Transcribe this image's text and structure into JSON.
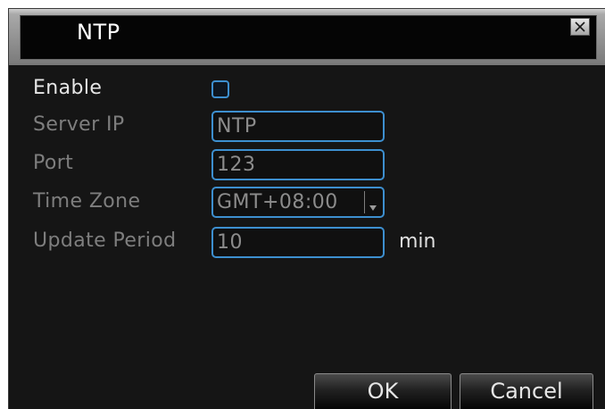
{
  "window": {
    "title": "NTP"
  },
  "form": {
    "enable_label": "Enable",
    "enable_checked": false,
    "server_ip_label": "Server IP",
    "server_ip_value": "NTP",
    "port_label": "Port",
    "port_value": "123",
    "time_zone_label": "Time Zone",
    "time_zone_value": "GMT+08:00",
    "update_period_label": "Update Period",
    "update_period_value": "10",
    "update_period_unit": "min"
  },
  "buttons": {
    "ok_label": "OK",
    "cancel_label": "Cancel"
  },
  "icons": {
    "close": "close-icon",
    "dropdown": "chevron-down-icon"
  },
  "colors": {
    "accent": "#3d8fcf",
    "background": "#151515",
    "label_dim": "#7e7e7e",
    "label_bright": "#e6e6e6"
  }
}
